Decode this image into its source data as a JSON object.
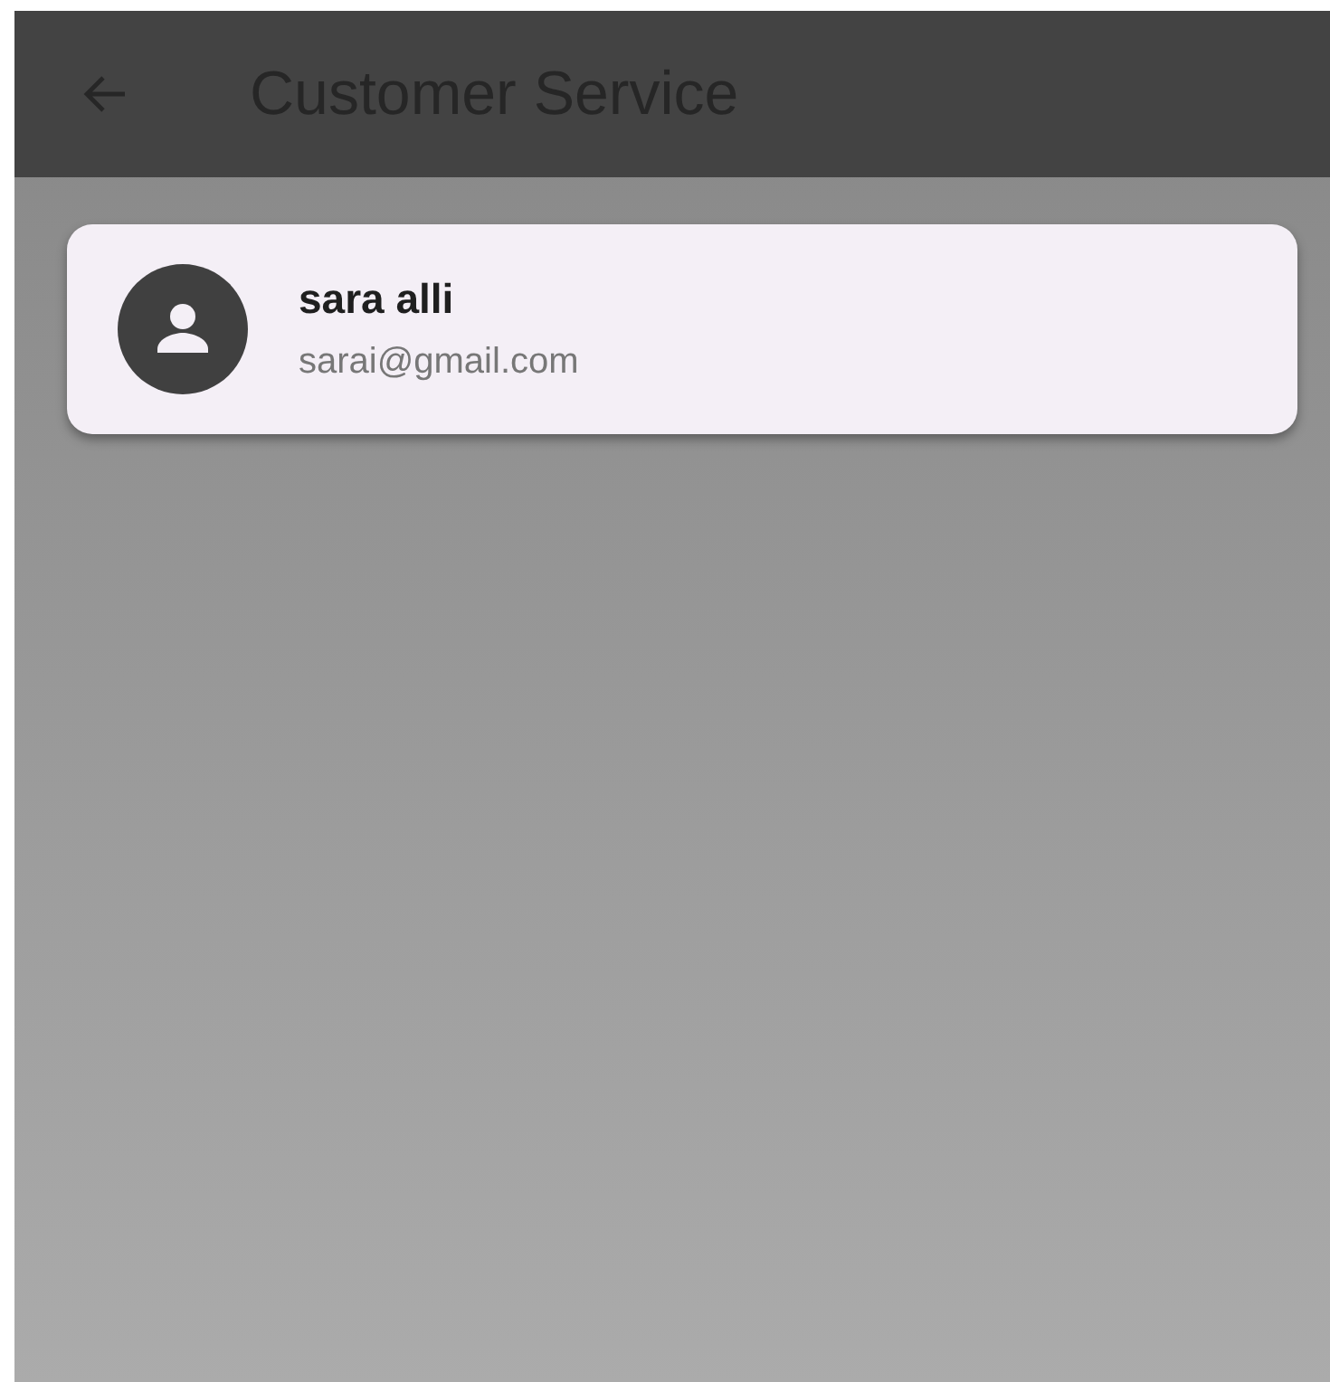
{
  "app_bar": {
    "title": "Customer Service"
  },
  "contacts": [
    {
      "name": "sara alli",
      "email": "sarai@gmail.com"
    }
  ]
}
